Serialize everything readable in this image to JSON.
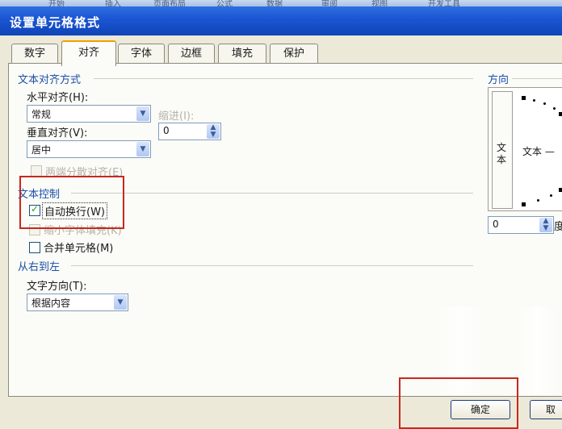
{
  "ribbon_tabs": [
    "开始",
    "插入",
    "页面布局",
    "公式",
    "数据",
    "审阅",
    "视图",
    "开发工具"
  ],
  "dialog": {
    "title": "设置单元格格式"
  },
  "tabs": [
    {
      "label": "数字",
      "active": false
    },
    {
      "label": "对齐",
      "active": true
    },
    {
      "label": "字体",
      "active": false
    },
    {
      "label": "边框",
      "active": false
    },
    {
      "label": "填充",
      "active": false
    },
    {
      "label": "保护",
      "active": false
    }
  ],
  "alignment": {
    "group_title": "文本对齐方式",
    "horizontal_label": "水平对齐(H):",
    "horizontal_value": "常规",
    "indent_label": "缩进(I):",
    "indent_value": "0",
    "vertical_label": "垂直对齐(V):",
    "vertical_value": "居中",
    "justify_distributed_label": "两端分散对齐(E)",
    "justify_distributed_checked": false,
    "justify_distributed_enabled": false
  },
  "text_control": {
    "group_title": "文本控制",
    "wrap_text_label": "自动换行(W)",
    "wrap_text_checked": true,
    "shrink_to_fit_label": "缩小字体填充(K)",
    "shrink_to_fit_checked": false,
    "shrink_to_fit_enabled": false,
    "merge_cells_label": "合并单元格(M)",
    "merge_cells_checked": false
  },
  "rtl": {
    "group_title": "从右到左",
    "text_direction_label": "文字方向(T):",
    "text_direction_value": "根据内容"
  },
  "orientation": {
    "group_title": "方向",
    "vertical_text": "文本",
    "horizontal_text": "文本 —",
    "degrees_value": "0",
    "degrees_unit": "度"
  },
  "buttons": {
    "ok": "确定",
    "cancel": "取"
  },
  "colors": {
    "title_bar": "#1c56d4",
    "group_title": "#1a4fa8",
    "highlight_box": "#c8281e",
    "check": "#21a121"
  }
}
